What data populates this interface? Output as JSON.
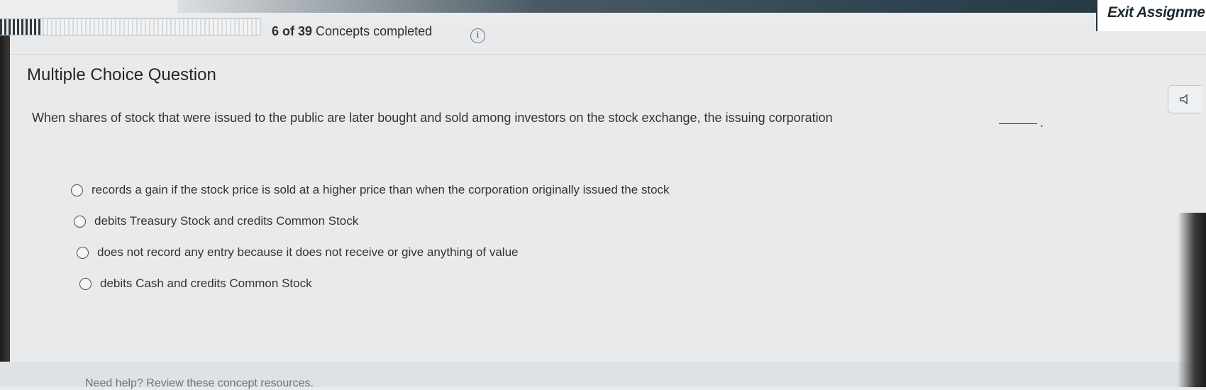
{
  "header": {
    "exit_label": "Exit Assignme",
    "progress": {
      "completed": 6,
      "total": 39,
      "count_text": "6 of 39",
      "suffix_text": "Concepts completed"
    },
    "info_icon": "info-icon"
  },
  "question": {
    "heading": "Multiple Choice Question",
    "stem": "When shares of stock that were issued to the public are later bought and sold among investors on the stock exchange, the issuing corporation",
    "stem_end": ".",
    "audio_icon": "speaker-icon",
    "options": [
      {
        "label": "records a gain if the stock price is sold at a higher price than when the corporation originally issued the stock"
      },
      {
        "label": "debits Treasury Stock and credits Common Stock"
      },
      {
        "label": "does not record any entry because it does not receive or give anything of value"
      },
      {
        "label": "debits Cash and credits Common Stock"
      }
    ]
  },
  "footer": {
    "cut_text": "Need help? Review these concept resources."
  }
}
